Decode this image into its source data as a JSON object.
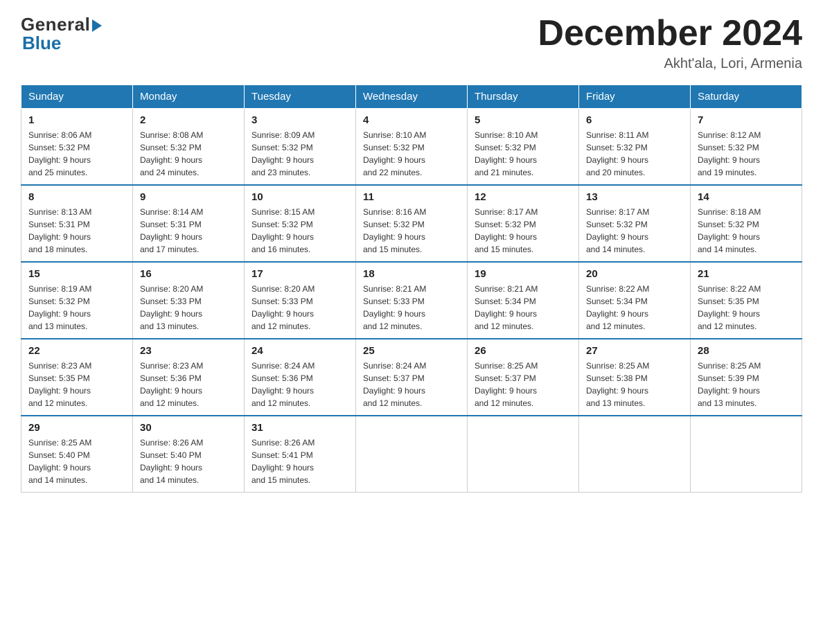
{
  "header": {
    "logo_general": "General",
    "logo_blue": "Blue",
    "month_title": "December 2024",
    "location": "Akht'ala, Lori, Armenia"
  },
  "days_of_week": [
    "Sunday",
    "Monday",
    "Tuesday",
    "Wednesday",
    "Thursday",
    "Friday",
    "Saturday"
  ],
  "weeks": [
    [
      {
        "num": "1",
        "sunrise": "8:06 AM",
        "sunset": "5:32 PM",
        "daylight": "9 hours and 25 minutes."
      },
      {
        "num": "2",
        "sunrise": "8:08 AM",
        "sunset": "5:32 PM",
        "daylight": "9 hours and 24 minutes."
      },
      {
        "num": "3",
        "sunrise": "8:09 AM",
        "sunset": "5:32 PM",
        "daylight": "9 hours and 23 minutes."
      },
      {
        "num": "4",
        "sunrise": "8:10 AM",
        "sunset": "5:32 PM",
        "daylight": "9 hours and 22 minutes."
      },
      {
        "num": "5",
        "sunrise": "8:10 AM",
        "sunset": "5:32 PM",
        "daylight": "9 hours and 21 minutes."
      },
      {
        "num": "6",
        "sunrise": "8:11 AM",
        "sunset": "5:32 PM",
        "daylight": "9 hours and 20 minutes."
      },
      {
        "num": "7",
        "sunrise": "8:12 AM",
        "sunset": "5:32 PM",
        "daylight": "9 hours and 19 minutes."
      }
    ],
    [
      {
        "num": "8",
        "sunrise": "8:13 AM",
        "sunset": "5:31 PM",
        "daylight": "9 hours and 18 minutes."
      },
      {
        "num": "9",
        "sunrise": "8:14 AM",
        "sunset": "5:31 PM",
        "daylight": "9 hours and 17 minutes."
      },
      {
        "num": "10",
        "sunrise": "8:15 AM",
        "sunset": "5:32 PM",
        "daylight": "9 hours and 16 minutes."
      },
      {
        "num": "11",
        "sunrise": "8:16 AM",
        "sunset": "5:32 PM",
        "daylight": "9 hours and 15 minutes."
      },
      {
        "num": "12",
        "sunrise": "8:17 AM",
        "sunset": "5:32 PM",
        "daylight": "9 hours and 15 minutes."
      },
      {
        "num": "13",
        "sunrise": "8:17 AM",
        "sunset": "5:32 PM",
        "daylight": "9 hours and 14 minutes."
      },
      {
        "num": "14",
        "sunrise": "8:18 AM",
        "sunset": "5:32 PM",
        "daylight": "9 hours and 14 minutes."
      }
    ],
    [
      {
        "num": "15",
        "sunrise": "8:19 AM",
        "sunset": "5:32 PM",
        "daylight": "9 hours and 13 minutes."
      },
      {
        "num": "16",
        "sunrise": "8:20 AM",
        "sunset": "5:33 PM",
        "daylight": "9 hours and 13 minutes."
      },
      {
        "num": "17",
        "sunrise": "8:20 AM",
        "sunset": "5:33 PM",
        "daylight": "9 hours and 12 minutes."
      },
      {
        "num": "18",
        "sunrise": "8:21 AM",
        "sunset": "5:33 PM",
        "daylight": "9 hours and 12 minutes."
      },
      {
        "num": "19",
        "sunrise": "8:21 AM",
        "sunset": "5:34 PM",
        "daylight": "9 hours and 12 minutes."
      },
      {
        "num": "20",
        "sunrise": "8:22 AM",
        "sunset": "5:34 PM",
        "daylight": "9 hours and 12 minutes."
      },
      {
        "num": "21",
        "sunrise": "8:22 AM",
        "sunset": "5:35 PM",
        "daylight": "9 hours and 12 minutes."
      }
    ],
    [
      {
        "num": "22",
        "sunrise": "8:23 AM",
        "sunset": "5:35 PM",
        "daylight": "9 hours and 12 minutes."
      },
      {
        "num": "23",
        "sunrise": "8:23 AM",
        "sunset": "5:36 PM",
        "daylight": "9 hours and 12 minutes."
      },
      {
        "num": "24",
        "sunrise": "8:24 AM",
        "sunset": "5:36 PM",
        "daylight": "9 hours and 12 minutes."
      },
      {
        "num": "25",
        "sunrise": "8:24 AM",
        "sunset": "5:37 PM",
        "daylight": "9 hours and 12 minutes."
      },
      {
        "num": "26",
        "sunrise": "8:25 AM",
        "sunset": "5:37 PM",
        "daylight": "9 hours and 12 minutes."
      },
      {
        "num": "27",
        "sunrise": "8:25 AM",
        "sunset": "5:38 PM",
        "daylight": "9 hours and 13 minutes."
      },
      {
        "num": "28",
        "sunrise": "8:25 AM",
        "sunset": "5:39 PM",
        "daylight": "9 hours and 13 minutes."
      }
    ],
    [
      {
        "num": "29",
        "sunrise": "8:25 AM",
        "sunset": "5:40 PM",
        "daylight": "9 hours and 14 minutes."
      },
      {
        "num": "30",
        "sunrise": "8:26 AM",
        "sunset": "5:40 PM",
        "daylight": "9 hours and 14 minutes."
      },
      {
        "num": "31",
        "sunrise": "8:26 AM",
        "sunset": "5:41 PM",
        "daylight": "9 hours and 15 minutes."
      },
      null,
      null,
      null,
      null
    ]
  ],
  "labels": {
    "sunrise": "Sunrise: ",
    "sunset": "Sunset: ",
    "daylight": "Daylight: "
  }
}
